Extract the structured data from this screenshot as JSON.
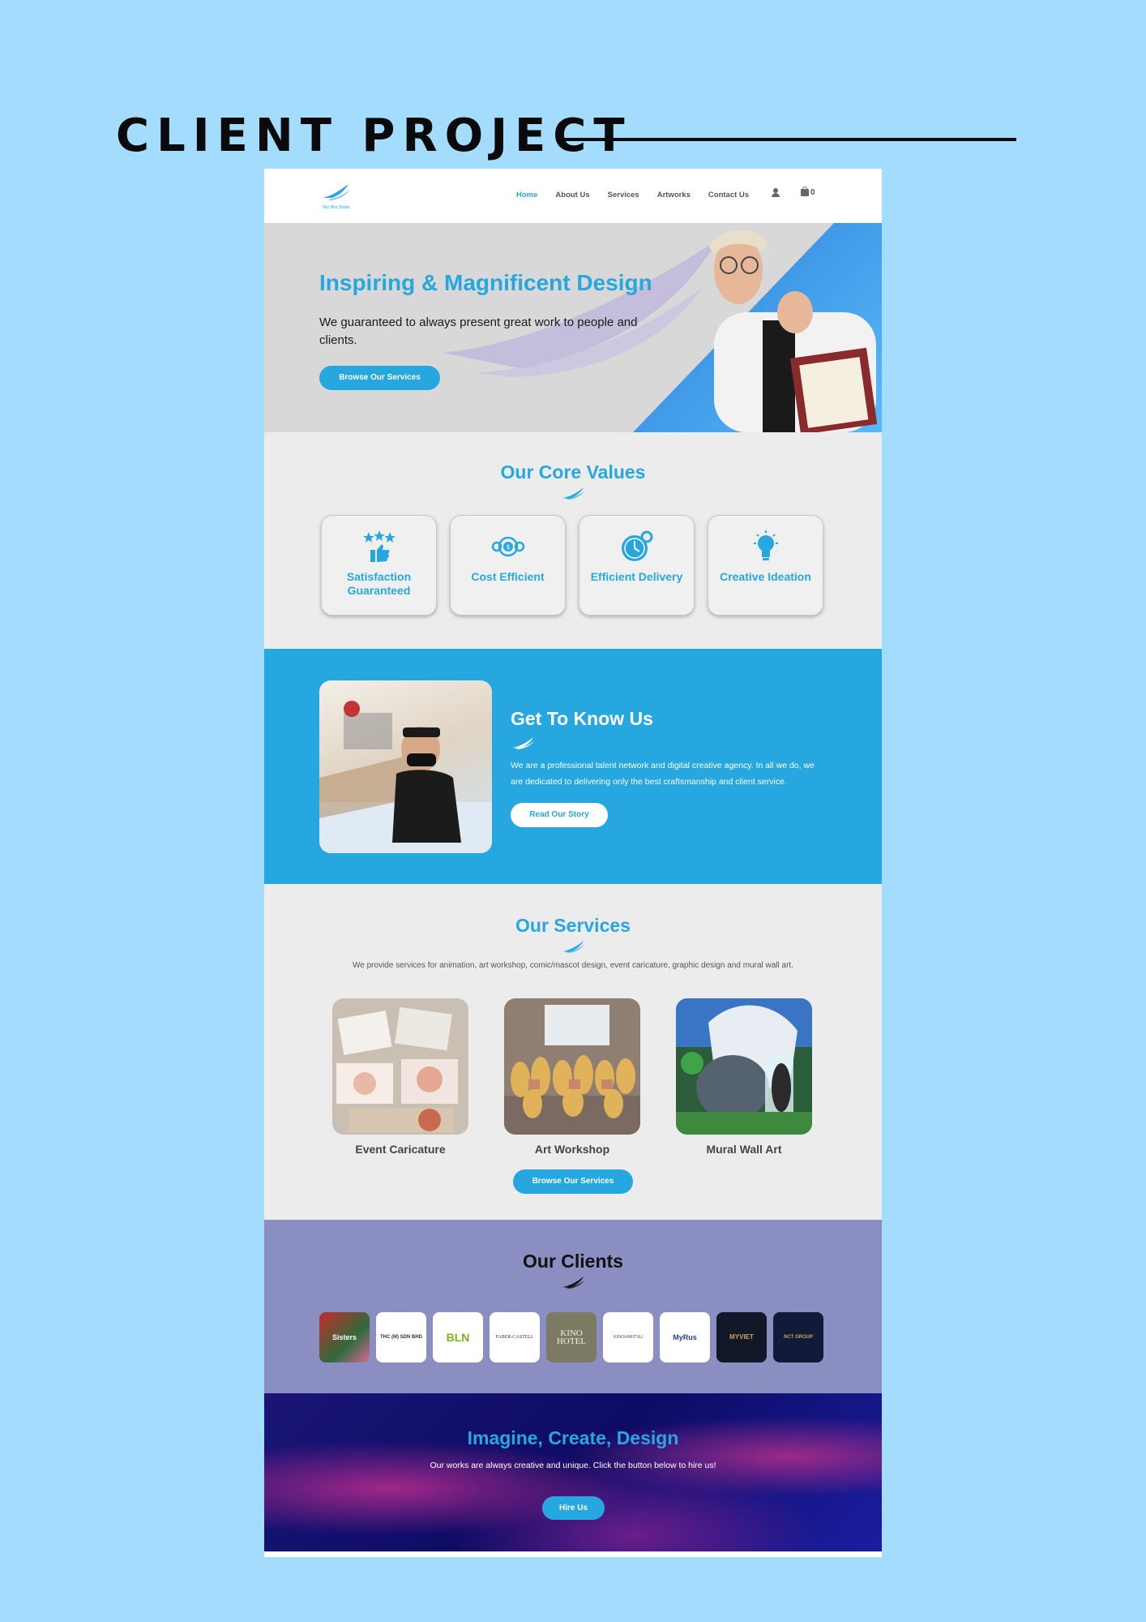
{
  "poster": {
    "title": "CLIENT PROJECT"
  },
  "header": {
    "logo_text": "Sky Bird Studio",
    "nav": [
      "Home",
      "About Us",
      "Services",
      "Artworks",
      "Contact Us"
    ],
    "cart_count": "0"
  },
  "hero": {
    "title": "Inspiring & Magnificent Design",
    "subtitle": "We guaranteed to always present great work to people and clients.",
    "button": "Browse Our Services"
  },
  "values": {
    "title": "Our Core Values",
    "cards": [
      {
        "label": "Satisfaction Guaranteed",
        "icon": "thumbs-up-stars-icon"
      },
      {
        "label": "Cost Efficient",
        "icon": "coin-gears-icon"
      },
      {
        "label": "Efficient Delivery",
        "icon": "clock-gear-icon"
      },
      {
        "label": "Creative Ideation",
        "icon": "lightbulb-icon"
      }
    ]
  },
  "about": {
    "title": "Get To Know Us",
    "text": "We are a professional talent network and digital creative agency. In all we do, we are dedicated to delivering only the best craftsmanship and client service.",
    "button": "Read Our Story"
  },
  "services": {
    "title": "Our Services",
    "description": "We provide services for animation, art workshop, comic/mascot design, event caricature, graphic design and mural wall art.",
    "items": [
      {
        "label": "Event Caricature"
      },
      {
        "label": "Art Workshop"
      },
      {
        "label": "Mural Wall Art"
      }
    ],
    "button": "Browse Our Services"
  },
  "clients": {
    "title": "Our Clients",
    "logos": [
      "Sisters",
      "THC (M) SDN BHD",
      "BLN",
      "FABER-CASTELL",
      "KINO HOTEL",
      "KINOHIMITSU",
      "MyRus",
      "MYVIET",
      "NCT GROUP"
    ]
  },
  "cta": {
    "title": "Imagine, Create, Design",
    "text": "Our works are always creative and unique. Click the button below to hire us!",
    "button": "Hire Us"
  },
  "colors": {
    "accent": "#27a7df",
    "background": "#a3dcfd",
    "clients_bg": "#8b8ec0",
    "cta_bg": "#0d0b63"
  }
}
